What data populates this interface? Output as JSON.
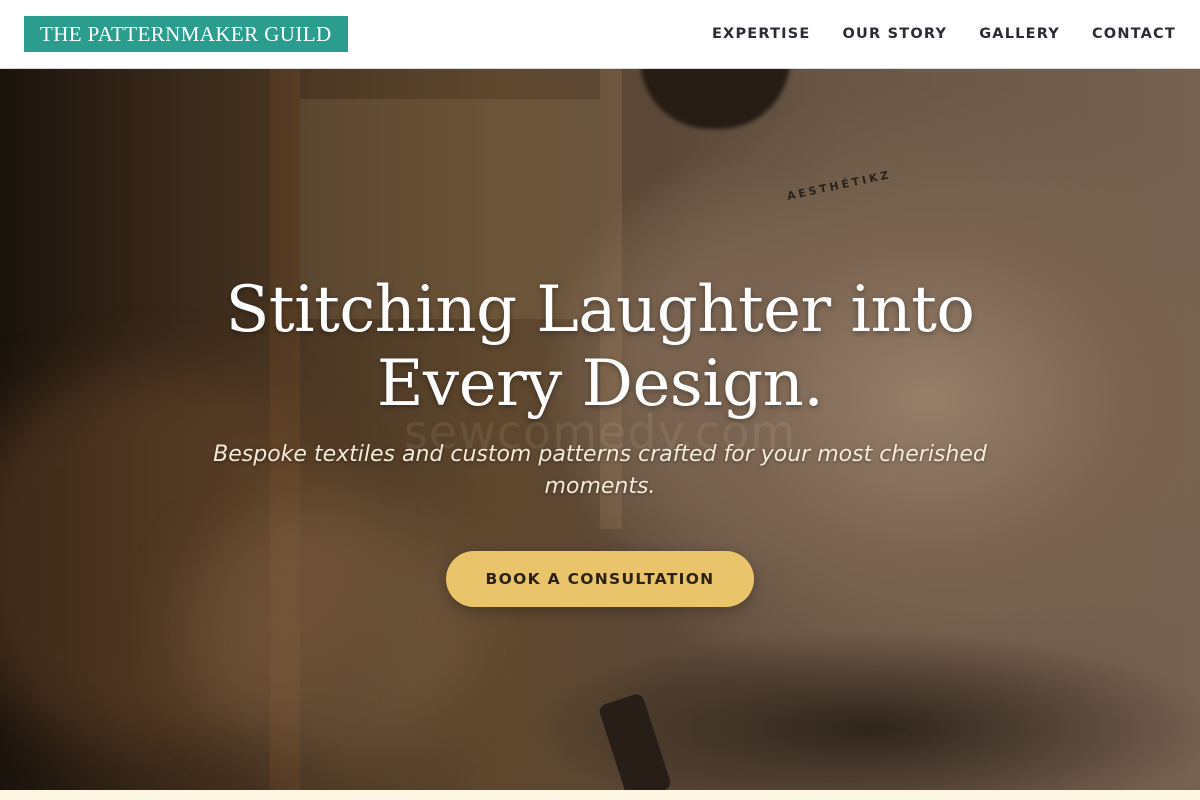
{
  "brand": {
    "name": "THE PATTERNMAKER GUILD"
  },
  "nav": {
    "items": [
      {
        "label": "EXPERTISE"
      },
      {
        "label": "OUR STORY"
      },
      {
        "label": "GALLERY"
      },
      {
        "label": "CONTACT"
      }
    ]
  },
  "hero": {
    "headline": "Stitching Laughter into Every Design.",
    "watermark": "sewcomedy.com",
    "subtitle": "Bespoke textiles and custom patterns crafted for your most cherished moments.",
    "cta_label": "BOOK A CONSULTATION",
    "shirt_print": "AESTHÉTIKZ"
  },
  "colors": {
    "brand_teal": "#2a9d8f",
    "cta_gold": "#e9c46a",
    "nav_text": "#2b2b33",
    "footer_cream": "#fdf6e3"
  }
}
